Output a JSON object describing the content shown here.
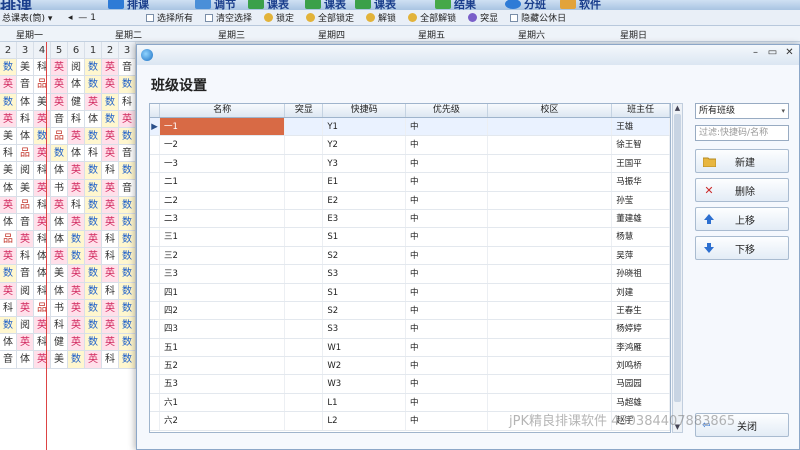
{
  "toolbar": {
    "app_title": "排课",
    "buttons": [
      "排课",
      "调节",
      "课表",
      "课表",
      "课表",
      "结果",
      "分班",
      "软件"
    ]
  },
  "subbar": {
    "view_select": "总课表(筒)",
    "nav_index": "1",
    "select_all": "选择所有",
    "clear_selection": "清空选择",
    "lock": "锁定",
    "lock_all": "全部锁定",
    "unlock": "解锁",
    "unlock_all": "全部解锁",
    "highlight": "突显",
    "hide_public_day": "隐藏公休日"
  },
  "week_days": [
    "星期一",
    "星期二",
    "星期三",
    "星期四",
    "星期五",
    "星期六",
    "星期日"
  ],
  "grid": {
    "header": [
      "2",
      "3",
      "4",
      "5",
      "6",
      "1",
      "2",
      "3"
    ],
    "rows": [
      [
        "数",
        "美",
        "科",
        "英",
        "阅",
        "数",
        "英",
        "音"
      ],
      [
        "英",
        "音",
        "品",
        "英",
        "体",
        "数",
        "英",
        "数"
      ],
      [
        "数",
        "体",
        "美",
        "英",
        "健",
        "英",
        "数",
        "科"
      ],
      [
        "英",
        "科",
        "英",
        "音",
        "科",
        "体",
        "数",
        "英"
      ],
      [
        "美",
        "体",
        "数",
        "品",
        "英",
        "数",
        "英",
        "数"
      ],
      [
        "科",
        "品",
        "英",
        "数",
        "体",
        "科",
        "英",
        "音"
      ],
      [
        "美",
        "阅",
        "科",
        "体",
        "英",
        "数",
        "科",
        "数"
      ],
      [
        "体",
        "美",
        "英",
        "书",
        "英",
        "数",
        "英",
        "音"
      ],
      [
        "英",
        "品",
        "科",
        "英",
        "科",
        "数",
        "英",
        "数"
      ],
      [
        "体",
        "音",
        "英",
        "体",
        "英",
        "数",
        "英",
        "数"
      ],
      [
        "品",
        "英",
        "科",
        "体",
        "数",
        "英",
        "科",
        "数"
      ],
      [
        "英",
        "科",
        "体",
        "英",
        "数",
        "英",
        "科",
        "数"
      ],
      [
        "数",
        "音",
        "体",
        "美",
        "英",
        "数",
        "英",
        "数"
      ],
      [
        "英",
        "阅",
        "科",
        "体",
        "英",
        "数",
        "科",
        "数"
      ],
      [
        "科",
        "英",
        "品",
        "书",
        "英",
        "数",
        "英",
        "数"
      ],
      [
        "数",
        "阅",
        "英",
        "科",
        "英",
        "数",
        "英",
        "数"
      ],
      [
        "体",
        "英",
        "科",
        "健",
        "英",
        "数",
        "英",
        "数"
      ],
      [
        "音",
        "体",
        "英",
        "美",
        "数",
        "英",
        "科",
        "数"
      ]
    ]
  },
  "dialog": {
    "title": "班级设置",
    "columns": [
      "名称",
      "突显",
      "快捷码",
      "优先级",
      "校区",
      "班主任"
    ],
    "rows": [
      {
        "name": "一1",
        "highlight": "",
        "code": "Y1",
        "priority": "中",
        "campus": "",
        "teacher": "王雄"
      },
      {
        "name": "一2",
        "highlight": "",
        "code": "Y2",
        "priority": "中",
        "campus": "",
        "teacher": "徐王智"
      },
      {
        "name": "一3",
        "highlight": "",
        "code": "Y3",
        "priority": "中",
        "campus": "",
        "teacher": "王国平"
      },
      {
        "name": "二1",
        "highlight": "",
        "code": "E1",
        "priority": "中",
        "campus": "",
        "teacher": "马振华"
      },
      {
        "name": "二2",
        "highlight": "",
        "code": "E2",
        "priority": "中",
        "campus": "",
        "teacher": "孙莹"
      },
      {
        "name": "二3",
        "highlight": "",
        "code": "E3",
        "priority": "中",
        "campus": "",
        "teacher": "董建雄"
      },
      {
        "name": "三1",
        "highlight": "",
        "code": "S1",
        "priority": "中",
        "campus": "",
        "teacher": "杨慧"
      },
      {
        "name": "三2",
        "highlight": "",
        "code": "S2",
        "priority": "中",
        "campus": "",
        "teacher": "吴萍"
      },
      {
        "name": "三3",
        "highlight": "",
        "code": "S3",
        "priority": "中",
        "campus": "",
        "teacher": "孙晓祖"
      },
      {
        "name": "四1",
        "highlight": "",
        "code": "S1",
        "priority": "中",
        "campus": "",
        "teacher": "刘建"
      },
      {
        "name": "四2",
        "highlight": "",
        "code": "S2",
        "priority": "中",
        "campus": "",
        "teacher": "王春生"
      },
      {
        "name": "四3",
        "highlight": "",
        "code": "S3",
        "priority": "中",
        "campus": "",
        "teacher": "杨婷婷"
      },
      {
        "name": "五1",
        "highlight": "",
        "code": "W1",
        "priority": "中",
        "campus": "",
        "teacher": "李鸿雁"
      },
      {
        "name": "五2",
        "highlight": "",
        "code": "W2",
        "priority": "中",
        "campus": "",
        "teacher": "刘鸣桥"
      },
      {
        "name": "五3",
        "highlight": "",
        "code": "W3",
        "priority": "中",
        "campus": "",
        "teacher": "马园园"
      },
      {
        "name": "六1",
        "highlight": "",
        "code": "L1",
        "priority": "中",
        "campus": "",
        "teacher": "马超雄"
      },
      {
        "name": "六2",
        "highlight": "",
        "code": "L2",
        "priority": "中",
        "campus": "",
        "teacher": "赵宇"
      }
    ],
    "filter_select": "所有班级",
    "filter_placeholder": "过滤:快捷码/名称",
    "buttons": {
      "new": "新建",
      "delete": "删除",
      "move_up": "上移",
      "move_down": "下移",
      "close": "关闭"
    }
  },
  "watermark": "jPK精良排课软件 450384407883865",
  "colors": {
    "selected_cell": "#d86a45",
    "accent": "#1a3e8c"
  }
}
